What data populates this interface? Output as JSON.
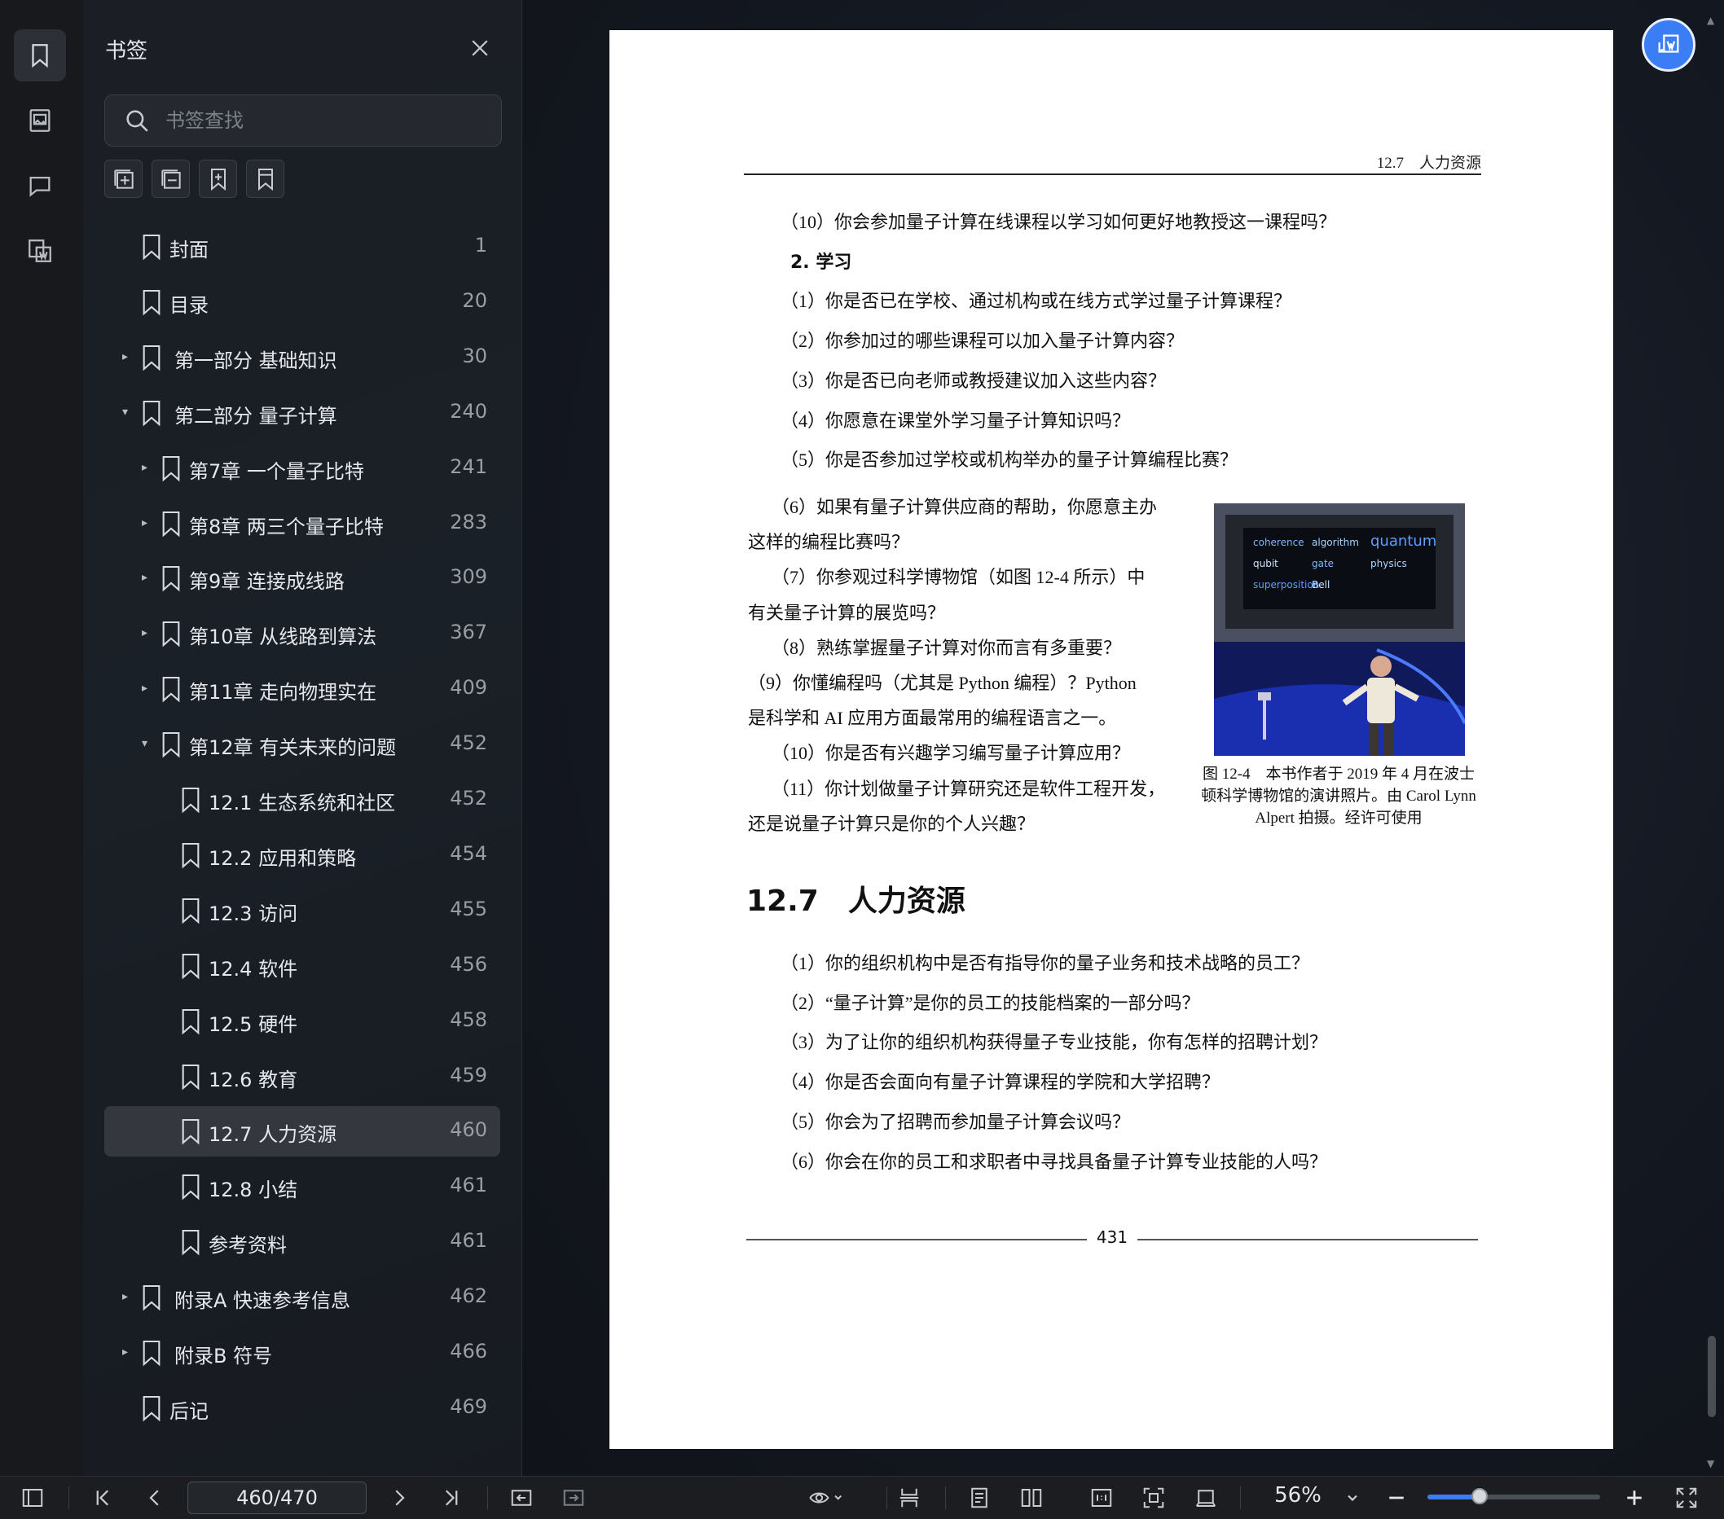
{
  "sidebar_panel": {
    "title": "书签",
    "search_placeholder": "书签查找",
    "bookmarks": [
      {
        "label": "封面",
        "page": "1",
        "level": 0,
        "arrow": "",
        "selected": false
      },
      {
        "label": "目录",
        "page": "20",
        "level": 0,
        "arrow": "",
        "selected": false
      },
      {
        "label": "第一部分 基础知识",
        "page": "30",
        "level": 0,
        "arrow": "▸",
        "selected": false
      },
      {
        "label": "第二部分 量子计算",
        "page": "240",
        "level": 0,
        "arrow": "▾",
        "selected": false
      },
      {
        "label": "第7章 一个量子比特",
        "page": "241",
        "level": 1,
        "arrow": "▸",
        "selected": false
      },
      {
        "label": "第8章 两三个量子比特",
        "page": "283",
        "level": 1,
        "arrow": "▸",
        "selected": false
      },
      {
        "label": "第9章 连接成线路",
        "page": "309",
        "level": 1,
        "arrow": "▸",
        "selected": false
      },
      {
        "label": "第10章 从线路到算法",
        "page": "367",
        "level": 1,
        "arrow": "▸",
        "selected": false
      },
      {
        "label": "第11章 走向物理实在",
        "page": "409",
        "level": 1,
        "arrow": "▸",
        "selected": false
      },
      {
        "label": "第12章 有关未来的问题",
        "page": "452",
        "level": 1,
        "arrow": "▾",
        "selected": false
      },
      {
        "label": "12.1 生态系统和社区",
        "page": "452",
        "level": 2,
        "arrow": "",
        "selected": false
      },
      {
        "label": "12.2 应用和策略",
        "page": "454",
        "level": 2,
        "arrow": "",
        "selected": false
      },
      {
        "label": "12.3 访问",
        "page": "455",
        "level": 2,
        "arrow": "",
        "selected": false
      },
      {
        "label": "12.4 软件",
        "page": "456",
        "level": 2,
        "arrow": "",
        "selected": false
      },
      {
        "label": "12.5 硬件",
        "page": "458",
        "level": 2,
        "arrow": "",
        "selected": false
      },
      {
        "label": "12.6 教育",
        "page": "459",
        "level": 2,
        "arrow": "",
        "selected": false
      },
      {
        "label": "12.7 人力资源",
        "page": "460",
        "level": 2,
        "arrow": "",
        "selected": true
      },
      {
        "label": "12.8 小结",
        "page": "461",
        "level": 2,
        "arrow": "",
        "selected": false
      },
      {
        "label": "参考资料",
        "page": "461",
        "level": 2,
        "arrow": "",
        "selected": false
      },
      {
        "label": "附录A 快速参考信息",
        "page": "462",
        "level": 0,
        "arrow": "▸",
        "selected": false
      },
      {
        "label": "附录B 符号",
        "page": "466",
        "level": 0,
        "arrow": "▸",
        "selected": false
      },
      {
        "label": "后记",
        "page": "469",
        "level": 0,
        "arrow": "",
        "selected": false
      }
    ]
  },
  "document": {
    "running_head": "12.7　人力资源",
    "lines_top": [
      "（10）你会参加量子计算在线课程以学习如何更好地教授这一课程吗？",
      "2. 学习",
      "（1）你是否已在学校、通过机构或在线方式学过量子计算课程？",
      "（2）你参加过的哪些课程可以加入量子计算内容？",
      "（3）你是否已向老师或教授建议加入这些内容？",
      "（4）你愿意在课堂外学习量子计算知识吗？",
      "（5）你是否参加过学校或机构举办的量子计算编程比赛？"
    ],
    "lines_wrap": [
      "（6）如果有量子计算供应商的帮助，你愿意主办",
      "这样的编程比赛吗？",
      "（7）你参观过科学博物馆（如图 12-4 所示）中",
      "有关量子计算的展览吗？",
      "（8）熟练掌握量子计算对你而言有多重要？",
      "（9）你懂编程吗（尤其是 Python 编程）？Python",
      "是科学和 AI 应用方面最常用的编程语言之一。",
      "（10）你是否有兴趣学习编写量子计算应用？",
      "（11）你计划做量子计算研究还是软件工程开发，",
      "还是说量子计算只是你的个人兴趣？"
    ],
    "figure_caption": "图 12-4　本书作者于 2019 年 4 月在波士顿科学博物馆的演讲照片。由 Carol Lynn Alpert 拍摄。经许可使用",
    "figure_words": [
      "coherence",
      "algorithm",
      "quantum",
      "qubit",
      "gate",
      "physics",
      "superposition",
      "Bell"
    ],
    "section_heading": "12.7　人力资源",
    "lines_hr": [
      "（1）你的组织机构中是否有指导你的量子业务和技术战略的员工？",
      "（2）“量子计算”是你的员工的技能档案的一部分吗？",
      "（3）为了让你的组织机构获得量子专业技能，你有怎样的招聘计划？",
      "（4）你是否会面向有量子计算课程的学院和大学招聘？",
      "（5）你会为了招聘而参加量子计算会议吗？",
      "（6）你会在你的员工和求职者中寻找具备量子计算专业技能的人吗？"
    ],
    "page_number": "431"
  },
  "bottom_bar": {
    "page_indicator": "460/470",
    "zoom_label": "56%",
    "zoom_fraction": 0.3
  },
  "colors": {
    "accent": "#3a7df5",
    "selected_row": "#34373e"
  }
}
